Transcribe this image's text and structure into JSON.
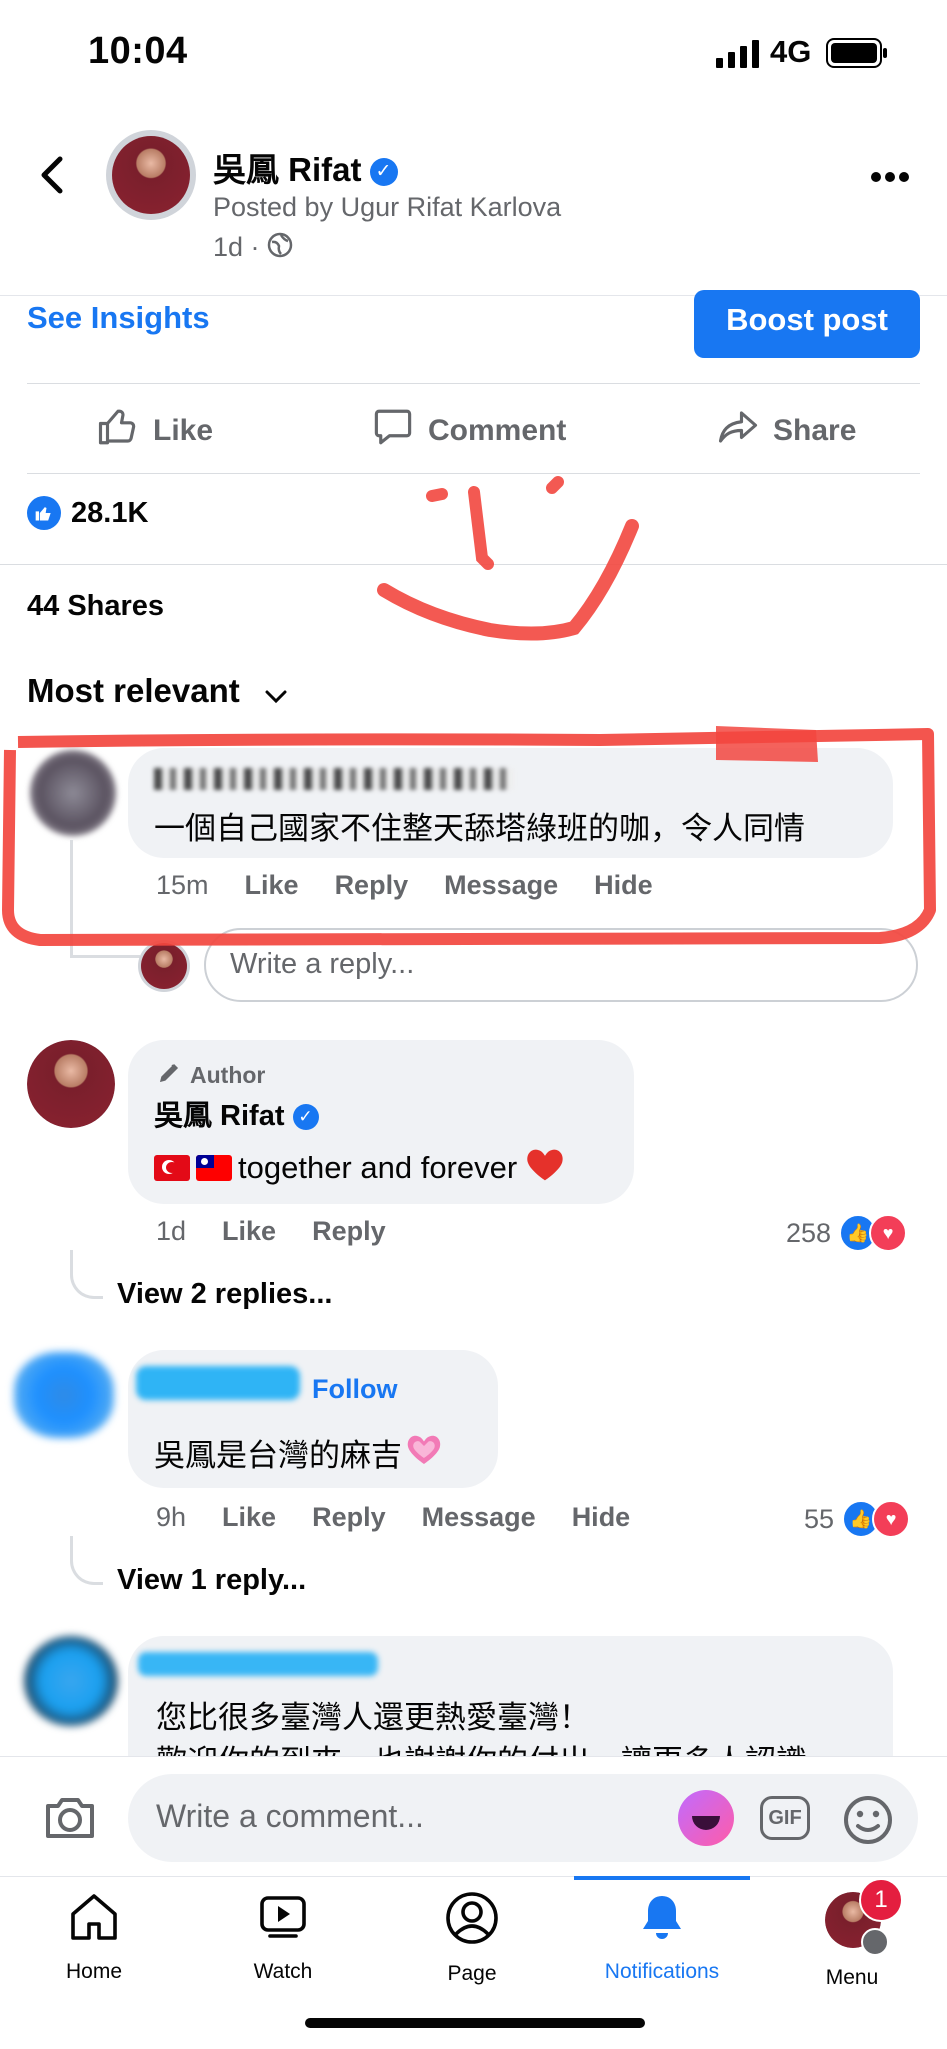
{
  "status_bar": {
    "time": "10:04",
    "network": "4G"
  },
  "header": {
    "page_name": "吳鳳 Rifat",
    "posted_by": "Posted by Ugur Rifat Karlova",
    "time": "1d ·"
  },
  "insights": {
    "see_insights": "See Insights",
    "boost": "Boost post"
  },
  "actions": {
    "like": "Like",
    "comment": "Comment",
    "share": "Share"
  },
  "reactions": {
    "count": "28.1K"
  },
  "shares": "44 Shares",
  "sort": {
    "label": "Most relevant"
  },
  "comments": [
    {
      "text": "一個自己國家不住整天舔塔綠班的咖，令人同情",
      "time": "15m",
      "actions": [
        "Like",
        "Reply",
        "Message",
        "Hide"
      ]
    },
    {
      "badge": "Author",
      "author": "吳鳳 Rifat",
      "text": "together and forever",
      "time": "1d",
      "actions": [
        "Like",
        "Reply"
      ],
      "reaction_count": "258",
      "view_replies": "View 2 replies..."
    },
    {
      "follow": "Follow",
      "text": "吳鳳是台灣的麻吉",
      "time": "9h",
      "actions": [
        "Like",
        "Reply",
        "Message",
        "Hide"
      ],
      "reaction_count": "55",
      "view_replies": "View 1 reply..."
    },
    {
      "text_line1": "您比很多臺灣人還更熱愛臺灣！",
      "text_line2": "歡迎你的到來，也謝謝你的付出，讓更多人認識"
    }
  ],
  "reply_placeholder": "Write a reply...",
  "composer": {
    "placeholder": "Write a comment...",
    "gif": "GIF"
  },
  "tabs": [
    {
      "label": "Home"
    },
    {
      "label": "Watch"
    },
    {
      "label": "Page"
    },
    {
      "label": "Notifications"
    },
    {
      "label": "Menu"
    }
  ],
  "menu_badge": "1",
  "colors": {
    "accent": "#1877f2",
    "annotation": "#f2473f",
    "heart": "#f33e58"
  }
}
